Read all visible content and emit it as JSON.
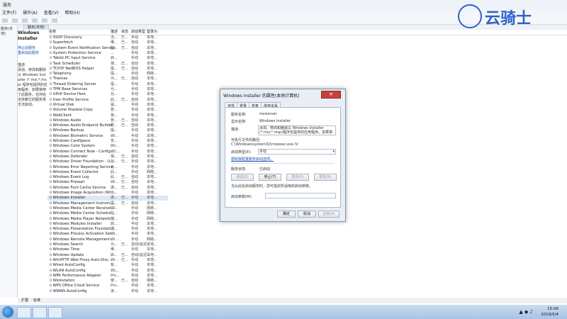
{
  "window": {
    "title": "服务"
  },
  "menu": [
    "文件(F)",
    "操作(A)",
    "查看(V)",
    "帮助(H)"
  ],
  "left_tree_label": "服务(本地)",
  "tab_label": "服务(本地)",
  "desc_pane": {
    "name": "Windows Installer",
    "link_stop": "停止此服务",
    "link_restart": "重启动此服务",
    "body": "描述:\n添加、修改和删除以 Windows Installer (*.msi,*.msp) 程序包提供的应用程序。如果禁用了此服务，任何完全依赖它的服务将无法启动。"
  },
  "columns": [
    "名称",
    "描述",
    "状态",
    "启动类型",
    "登录为"
  ],
  "rows": [
    {
      "name": "SSDP Discovery",
      "desc": "当...",
      "status": "已...",
      "start": "手动",
      "logon": "本地..."
    },
    {
      "name": "Superfetch",
      "desc": "维...",
      "status": "已...",
      "start": "自动",
      "logon": "本地..."
    },
    {
      "name": "System Event Notification Service",
      "desc": "监...",
      "status": "已...",
      "start": "自动",
      "logon": "本地..."
    },
    {
      "name": "System Protection Service",
      "desc": "...",
      "status": "",
      "start": "手动",
      "logon": "本地..."
    },
    {
      "name": "Tablet PC Input Service",
      "desc": "启...",
      "status": "",
      "start": "手动",
      "logon": "本地..."
    },
    {
      "name": "Task Scheduler",
      "desc": "使...",
      "status": "已...",
      "start": "自动",
      "logon": "本地..."
    },
    {
      "name": "TCP/IP NetBIOS Helper",
      "desc": "提...",
      "status": "已...",
      "start": "自动",
      "logon": "本地..."
    },
    {
      "name": "Telephony",
      "desc": "提...",
      "status": "",
      "start": "手动",
      "logon": "网络..."
    },
    {
      "name": "Themes",
      "desc": "为...",
      "status": "已...",
      "start": "自动",
      "logon": "本地..."
    },
    {
      "name": "Thread Ordering Server",
      "desc": "提...",
      "status": "",
      "start": "手动",
      "logon": "本地..."
    },
    {
      "name": "TPM Base Services",
      "desc": "允...",
      "status": "",
      "start": "手动",
      "logon": "本地..."
    },
    {
      "name": "UPnP Device Host",
      "desc": "允...",
      "status": "",
      "start": "手动",
      "logon": "本地..."
    },
    {
      "name": "User Profile Service",
      "desc": "此...",
      "status": "已...",
      "start": "自动",
      "logon": "本地..."
    },
    {
      "name": "Virtual Disk",
      "desc": "提...",
      "status": "",
      "start": "手动",
      "logon": "本地..."
    },
    {
      "name": "Volume Shadow Copy",
      "desc": "管...",
      "status": "",
      "start": "手动",
      "logon": "本地..."
    },
    {
      "name": "WebClient",
      "desc": "使...",
      "status": "",
      "start": "手动",
      "logon": "本地..."
    },
    {
      "name": "Windows Audio",
      "desc": "管...",
      "status": "已...",
      "start": "自动",
      "logon": "本地..."
    },
    {
      "name": "Windows Audio Endpoint Builder",
      "desc": "管...",
      "status": "已...",
      "start": "自动",
      "logon": "本地..."
    },
    {
      "name": "Windows Backup",
      "desc": "提...",
      "status": "",
      "start": "手动",
      "logon": "本地..."
    },
    {
      "name": "Windows Biometric Service",
      "desc": "Wi...",
      "status": "",
      "start": "手动",
      "logon": "本地..."
    },
    {
      "name": "Windows CardSpace",
      "desc": "安...",
      "status": "",
      "start": "手动",
      "logon": "本地..."
    },
    {
      "name": "Windows Color System",
      "desc": "Wc...",
      "status": "",
      "start": "手动",
      "logon": "本地..."
    },
    {
      "name": "Windows Connect Now - Config...",
      "desc": "WC...",
      "status": "",
      "start": "手动",
      "logon": "本地..."
    },
    {
      "name": "Windows Defender",
      "desc": "保...",
      "status": "已...",
      "start": "自动",
      "logon": "本地..."
    },
    {
      "name": "Windows Driver Foundation - U...",
      "desc": "创...",
      "status": "已...",
      "start": "手动",
      "logon": "本地..."
    },
    {
      "name": "Windows Error Reporting Service",
      "desc": "允...",
      "status": "",
      "start": "手动",
      "logon": "本地..."
    },
    {
      "name": "Windows Event Collector",
      "desc": "此...",
      "status": "",
      "start": "手动",
      "logon": "网络..."
    },
    {
      "name": "Windows Event Log",
      "desc": "此...",
      "status": "已...",
      "start": "自动",
      "logon": "本地..."
    },
    {
      "name": "Windows Firewall",
      "desc": "Wi...",
      "status": "已...",
      "start": "自动",
      "logon": "本地..."
    },
    {
      "name": "Windows Font Cache Service",
      "desc": "通...",
      "status": "已...",
      "start": "自动",
      "logon": "本地..."
    },
    {
      "name": "Windows Image Acquisition (WI...",
      "desc": "为...",
      "status": "",
      "start": "手动",
      "logon": "本地..."
    },
    {
      "name": "Windows Installer",
      "desc": "添...",
      "status": "已...",
      "start": "手动",
      "logon": "本地..."
    },
    {
      "name": "Windows Management Instrum...",
      "desc": "提...",
      "status": "已...",
      "start": "自动",
      "logon": "本地..."
    },
    {
      "name": "Windows Media Center Receive...",
      "desc": "Wi...",
      "status": "",
      "start": "手动",
      "logon": "网络..."
    },
    {
      "name": "Windows Media Center Schedul...",
      "desc": "在...",
      "status": "",
      "start": "手动",
      "logon": "网络..."
    },
    {
      "name": "Windows Media Player Network...",
      "desc": "使...",
      "status": "",
      "start": "手动",
      "logon": "网络..."
    },
    {
      "name": "Windows Modules Installer",
      "desc": "启...",
      "status": "",
      "start": "手动",
      "logon": "本地..."
    },
    {
      "name": "Windows Presentation Foundati...",
      "desc": "通...",
      "status": "",
      "start": "手动",
      "logon": "本地..."
    },
    {
      "name": "Windows Process Activation Ser...",
      "desc": "Wi...",
      "status": "",
      "start": "手动",
      "logon": "本地..."
    },
    {
      "name": "Windows Remote Management...",
      "desc": "Wi...",
      "status": "",
      "start": "手动",
      "logon": "网络..."
    },
    {
      "name": "Windows Search",
      "desc": "为...",
      "status": "已...",
      "start": "自动(延迟...",
      "logon": "本地..."
    },
    {
      "name": "Windows Time",
      "desc": "维...",
      "status": "",
      "start": "手动",
      "logon": "本地..."
    },
    {
      "name": "Windows Update",
      "desc": "启...",
      "status": "已...",
      "start": "自动(延迟...",
      "logon": "本地..."
    },
    {
      "name": "WinHTTP Web Proxy Auto-Disc...",
      "desc": "Wi...",
      "status": "已...",
      "start": "手动",
      "logon": "本地..."
    },
    {
      "name": "Wired AutoConfig",
      "desc": "有...",
      "status": "",
      "start": "手动",
      "logon": "本地..."
    },
    {
      "name": "WLAN AutoConfig",
      "desc": "WL...",
      "status": "",
      "start": "手动",
      "logon": "本地..."
    },
    {
      "name": "WMI Performance Adapter",
      "desc": "Pro...",
      "status": "",
      "start": "手动",
      "logon": "本地..."
    },
    {
      "name": "Workstation",
      "desc": "使...",
      "status": "已...",
      "start": "自动",
      "logon": "网络..."
    },
    {
      "name": "WPS Office Cloud Service",
      "desc": "Pro...",
      "status": "",
      "start": "手动",
      "logon": "本地..."
    },
    {
      "name": "WWAN AutoConfig",
      "desc": "该...",
      "status": "",
      "start": "手动",
      "logon": "本地..."
    }
  ],
  "status_tabs": [
    "扩展",
    "标准"
  ],
  "logo_text": "云骑士",
  "dialog": {
    "title": "Windows Installer 的属性(本地计算机)",
    "close": "✕",
    "tabs": [
      "常规",
      "登录",
      "恢复",
      "依存关系"
    ],
    "service_name_label": "服务名称:",
    "service_name": "msiserver",
    "display_name_label": "显示名称:",
    "display_name": "Windows Installer",
    "desc_label": "描述:",
    "desc": "添加、修改和删除以 Windows Installer (*.msi,*.msp)程序包提供的应用程序。如果禁用了此",
    "path_label": "可执行文件的路径:",
    "path": "C:\\Windows\\system32\\msiexec.exe /V",
    "startup_label": "启动类型(E):",
    "startup_value": "手动",
    "help_link": "帮助我配置服务启动选项。",
    "status_label": "服务状态:",
    "status_value": "已启动",
    "buttons": [
      "启动(S)",
      "停止(T)",
      "暂停(P)",
      "恢复(R)"
    ],
    "hint": "当从此处启动服务时，您可指定所适用的启动参数。",
    "params_label": "启动参数(M):",
    "ok": "确定",
    "cancel": "取消",
    "apply": "应用(A)"
  },
  "clock": {
    "time": "15:06",
    "date": "2019/5/4"
  }
}
